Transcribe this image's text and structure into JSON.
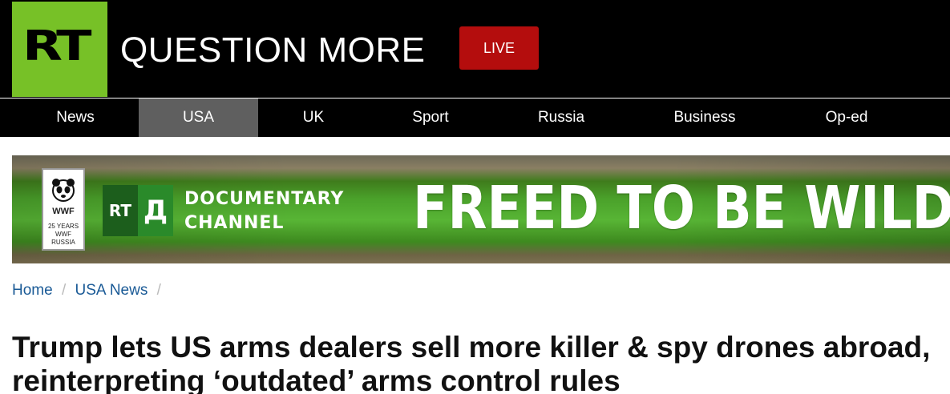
{
  "header": {
    "logo_text": "RT",
    "tagline": "QUESTION MORE",
    "live_label": "LIVE",
    "colors": {
      "logo_green": "#77c127",
      "live_red": "#b40d0d",
      "background": "#000000"
    }
  },
  "nav": {
    "items": [
      {
        "label": "News",
        "active": false
      },
      {
        "label": "USA",
        "active": true
      },
      {
        "label": "UK",
        "active": false
      },
      {
        "label": "Sport",
        "active": false
      },
      {
        "label": "Russia",
        "active": false
      },
      {
        "label": "Business",
        "active": false
      },
      {
        "label": "Op-ed",
        "active": false
      }
    ]
  },
  "banner": {
    "wwf_name": "WWF",
    "wwf_years": "25 YEARS",
    "wwf_sub": "WWF RUSSIA",
    "rtd_left": "RT",
    "rtd_right": "Д",
    "channel_line1": "DOCUMENTARY",
    "channel_line2": "CHANNEL",
    "slogan": "FREED TO BE WILD"
  },
  "breadcrumb": {
    "items": [
      "Home",
      "USA News"
    ],
    "separator": "/"
  },
  "article": {
    "headline": "Trump lets US arms dealers sell more killer & spy drones abroad, reinterpreting ‘outdated’ arms control rules"
  }
}
